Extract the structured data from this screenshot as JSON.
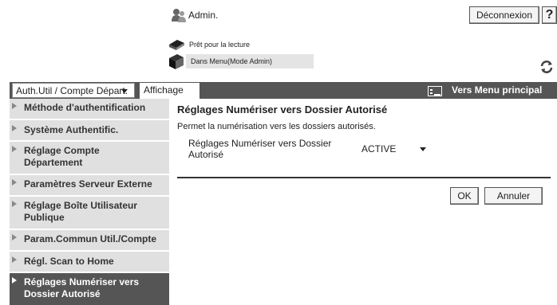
{
  "header": {
    "admin_label": "Admin.",
    "logout_label": "Déconnexion",
    "help_label": "?"
  },
  "status": {
    "line1": "Prêt pour la lecture",
    "line2": "Dans Menu(Mode Admin)"
  },
  "toolbar": {
    "auth_select_value": "Auth.Util / Compte Départ.",
    "tab_label": "Affichage",
    "main_menu_label": "Vers Menu principal"
  },
  "sidebar": {
    "items": [
      {
        "line1": "Méthode d'authentification",
        "line2": ""
      },
      {
        "line1": "Système Authentific.",
        "line2": ""
      },
      {
        "line1": "Réglage Compte",
        "line2": "Département"
      },
      {
        "line1": "Paramètres Serveur Externe",
        "line2": ""
      },
      {
        "line1": "Réglage Boîte Utilisateur",
        "line2": "Publique"
      },
      {
        "line1": "Param.Commun Util./Compte",
        "line2": ""
      },
      {
        "line1": "Régl. Scan to Home",
        "line2": ""
      },
      {
        "line1": "Réglages Numériser vers",
        "line2": "Dossier Autorisé"
      }
    ],
    "active_index": 7
  },
  "main": {
    "title": "Réglages Numériser vers Dossier Autorisé",
    "description": "Permet la numérisation vers les dossiers autorisés.",
    "field_label_line1": "Réglages Numériser vers Dossier",
    "field_label_line2": "Autorisé",
    "field_value": "ACTIVE",
    "ok_label": "OK",
    "cancel_label": "Annuler"
  },
  "colors": {
    "toolbar_bg": "#555555",
    "sidebar_bg": "#e0e0e0",
    "sidebar_active_bg": "#555555"
  }
}
